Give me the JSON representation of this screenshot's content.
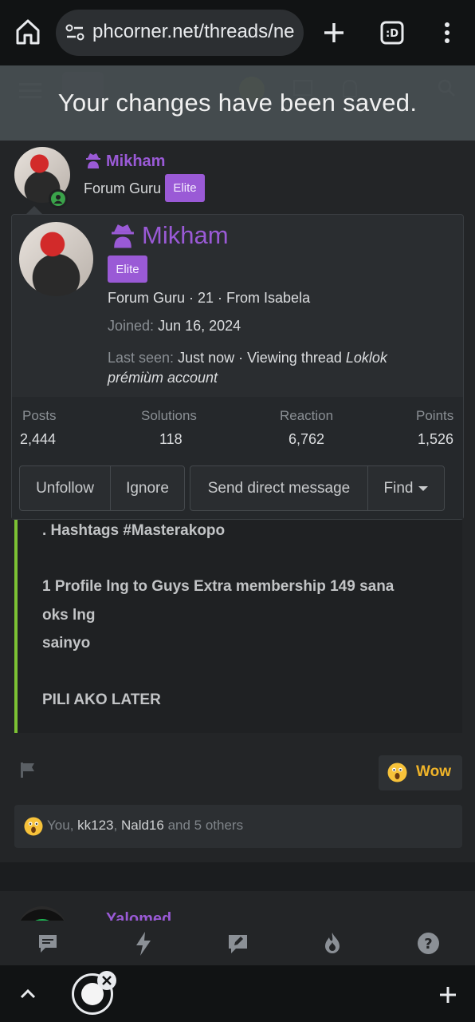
{
  "browser": {
    "url": "phcorner.net/threads/ne"
  },
  "notice": {
    "text": "Your changes have been saved."
  },
  "post_header": {
    "username": "Mikham",
    "title": "Forum Guru",
    "badge": "Elite"
  },
  "popup": {
    "username": "Mikham",
    "badge": "Elite",
    "info_line": "Forum Guru · 21 · From Isabela",
    "joined_label": "Joined:",
    "joined_value": "Jun 16, 2024",
    "last_seen_label": "Last seen:",
    "last_seen_value": "Just now · Viewing thread",
    "thread_title_1": "Loklok",
    "thread_title_2": "prémiùm account",
    "stats": [
      {
        "label": "Posts",
        "value": "2,444"
      },
      {
        "label": "Solutions",
        "value": "118"
      },
      {
        "label": "Reaction",
        "value": "6,762"
      },
      {
        "label": "Points",
        "value": "1,526"
      }
    ],
    "buttons": {
      "unfollow": "Unfollow",
      "ignore": "Ignore",
      "message": "Send direct message",
      "find": "Find"
    }
  },
  "post": {
    "line1": ". Hashtags #Masterakopo",
    "line2": "1 Profile lng to Guys Extra membership 149 sana",
    "line3": "oks lng",
    "line4": "sainyo",
    "line5": "PILI AKO LATER"
  },
  "reactions": {
    "wow_label": "Wow",
    "you": "You",
    "user1": "kk123",
    "user2": "Nald16",
    "others": "and 5 others"
  },
  "next_post": {
    "username": "Yalomed"
  },
  "colors": {
    "accent": "#9a5ad6",
    "quote_bar": "#7cc234",
    "wow": "#f0b429"
  }
}
